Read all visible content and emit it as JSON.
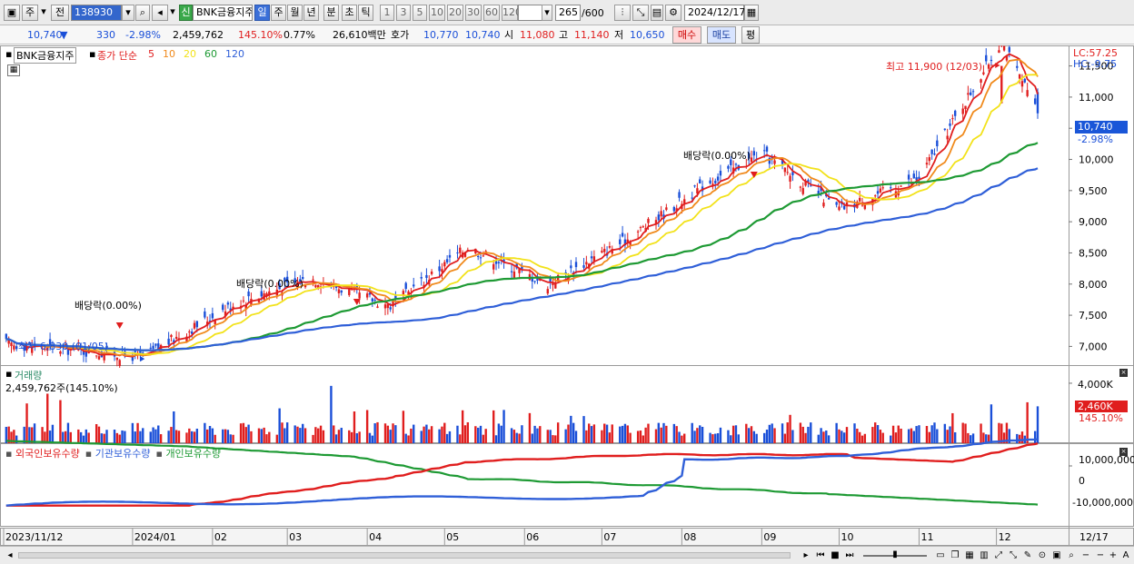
{
  "toolbar": {
    "mode_btn": "주",
    "prev_btn": "전",
    "code_value": "138930",
    "stock_name": "BNK금융지주",
    "badge": "신",
    "periods": [
      "일",
      "주",
      "월",
      "년",
      "분",
      "초",
      "틱"
    ],
    "active_period": "일",
    "intervals": [
      "1",
      "3",
      "5",
      "10",
      "20",
      "30",
      "60",
      "120"
    ],
    "count_value": "265",
    "count_total": "/600",
    "date_value": "2024/12/17"
  },
  "quote": {
    "price": "10,740",
    "change": "330",
    "change_pct": "-2.98%",
    "volume": "2,459,762",
    "volume_ratio": "145.10%",
    "turnover": "0.77%",
    "amount": "26,610백만",
    "ask_label": "호가",
    "ask": "10,770",
    "bid": "10,740",
    "open_label": "시",
    "open": "11,080",
    "high_label": "고",
    "high": "11,140",
    "low_label": "저",
    "low": "10,650",
    "buy_btn": "매수",
    "sell_btn": "매도",
    "eval_btn": "평"
  },
  "price_panel": {
    "stock_label": "BNK금융지주",
    "legend_prefix": "종가 단순",
    "ma_legend": [
      {
        "label": "5",
        "color": "#e01e1e"
      },
      {
        "label": "10",
        "color": "#f08a1c"
      },
      {
        "label": "20",
        "color": "#f2e21a"
      },
      {
        "label": "60",
        "color": "#1e9a34"
      },
      {
        "label": "120",
        "color": "#2f5fd8"
      }
    ],
    "lc_label": "LC:57.25",
    "hc_label": "HC:-9.75",
    "current_price_tag": "10,740",
    "current_pct_tag": "-2.98%",
    "high_annotation": "최고 11,900 (12/03)",
    "low_annotation": "최저 6,830 (01/05)",
    "dividend_label": "배당락(0.00%)"
  },
  "volume_panel": {
    "title": "거래량",
    "value": "2,459,762주(145.10%)",
    "tag": "2,460K",
    "tag_pct": "145.10%",
    "axis_top": "4,000K"
  },
  "holding_panel": {
    "series": [
      {
        "label": "외국인보유수량",
        "color": "#e01e1e"
      },
      {
        "label": "기관보유수량",
        "color": "#2f5fd8"
      },
      {
        "label": "개인보유수량",
        "color": "#1e9a34"
      }
    ],
    "y_ticks": [
      "10,000,000",
      "0",
      "-10,000,000"
    ]
  },
  "x_axis": {
    "labels": [
      "2023/11/12",
      "2024/01",
      "02",
      "03",
      "04",
      "05",
      "06",
      "07",
      "08",
      "09",
      "10",
      "11",
      "12",
      "12/17"
    ]
  },
  "chart_data": {
    "type": "candlestick",
    "y_ticks": [
      7000,
      7500,
      8000,
      8500,
      9000,
      9500,
      10000,
      10500,
      11000,
      11500
    ],
    "ylim": [
      6700,
      11800
    ],
    "key_points": [
      {
        "date": "2023-11-12",
        "close": 7050
      },
      {
        "date": "2024-01-05",
        "low": 6830
      },
      {
        "date": "2024-02-10",
        "close": 7700
      },
      {
        "date": "2024-03-10",
        "close": 8100
      },
      {
        "date": "2024-04-10",
        "close": 7650
      },
      {
        "date": "2024-05-10",
        "close": 8600
      },
      {
        "date": "2024-06-10",
        "close": 8000
      },
      {
        "date": "2024-07-10",
        "close": 8700
      },
      {
        "date": "2024-08-10",
        "close": 9600
      },
      {
        "date": "2024-09-01",
        "close": 10100
      },
      {
        "date": "2024-10-01",
        "close": 9200
      },
      {
        "date": "2024-11-01",
        "close": 9700
      },
      {
        "date": "2024-12-03",
        "high": 11900
      },
      {
        "date": "2024-12-17",
        "close": 10740
      }
    ]
  }
}
